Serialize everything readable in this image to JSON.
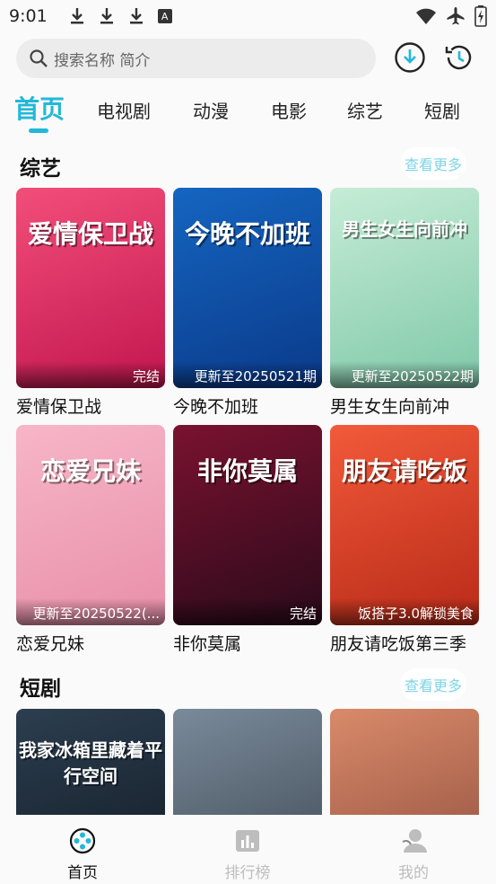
{
  "status_bar": {
    "time": "9:01",
    "a_label": "A"
  },
  "search": {
    "placeholder": "搜索名称 简介"
  },
  "tabs": [
    {
      "label": "首页",
      "active": true
    },
    {
      "label": "电视剧"
    },
    {
      "label": "动漫"
    },
    {
      "label": "电影"
    },
    {
      "label": "综艺"
    },
    {
      "label": "短剧"
    }
  ],
  "sections": [
    {
      "title": "综艺",
      "more_label": "查看更多",
      "items": [
        {
          "name": "爱情保卫战",
          "badge": "完结",
          "poster_title": "爱情保卫战",
          "colors": [
            "#f24e7a",
            "#c2164f"
          ]
        },
        {
          "name": "今晚不加班",
          "badge": "更新至20250521期",
          "poster_title": "今晚不加班",
          "colors": [
            "#1565c0",
            "#0a3a8a"
          ]
        },
        {
          "name": "男生女生向前冲",
          "badge": "更新至20250522期",
          "poster_title": "男生女生向前冲",
          "colors": [
            "#c6ecd6",
            "#7fc8a9"
          ]
        },
        {
          "name": "恋爱兄妹",
          "badge": "更新至20250522(...",
          "poster_title": "恋爱兄妹",
          "colors": [
            "#f7b6c7",
            "#e88fa9"
          ]
        },
        {
          "name": "非你莫属",
          "badge": "完结",
          "poster_title": "非你莫属",
          "colors": [
            "#7a1230",
            "#2a0a1a"
          ]
        },
        {
          "name": "朋友请吃饭第三季",
          "badge": "饭搭子3.0解锁美食",
          "poster_title": "朋友请吃饭",
          "colors": [
            "#f25a3a",
            "#b82a18"
          ]
        }
      ]
    },
    {
      "title": "短剧",
      "more_label": "查看更多",
      "items": [
        {
          "name": "",
          "badge": "",
          "poster_title": "我家冰箱里藏着平行空间",
          "colors": [
            "#2c3e50",
            "#101822"
          ]
        },
        {
          "name": "",
          "badge": "",
          "poster_title": "",
          "colors": [
            "#7a8a9a",
            "#3a4450"
          ]
        },
        {
          "name": "",
          "badge": "",
          "poster_title": "",
          "colors": [
            "#d98a6a",
            "#8a4a3a"
          ]
        }
      ]
    }
  ],
  "bottom_nav": [
    {
      "label": "首页",
      "icon": "film-reel-icon",
      "active": true
    },
    {
      "label": "排行榜",
      "icon": "chart-icon",
      "active": false
    },
    {
      "label": "我的",
      "icon": "user-icon",
      "active": false
    }
  ],
  "colors": {
    "accent": "#22b8d8",
    "more_text": "#7fd4e6"
  }
}
